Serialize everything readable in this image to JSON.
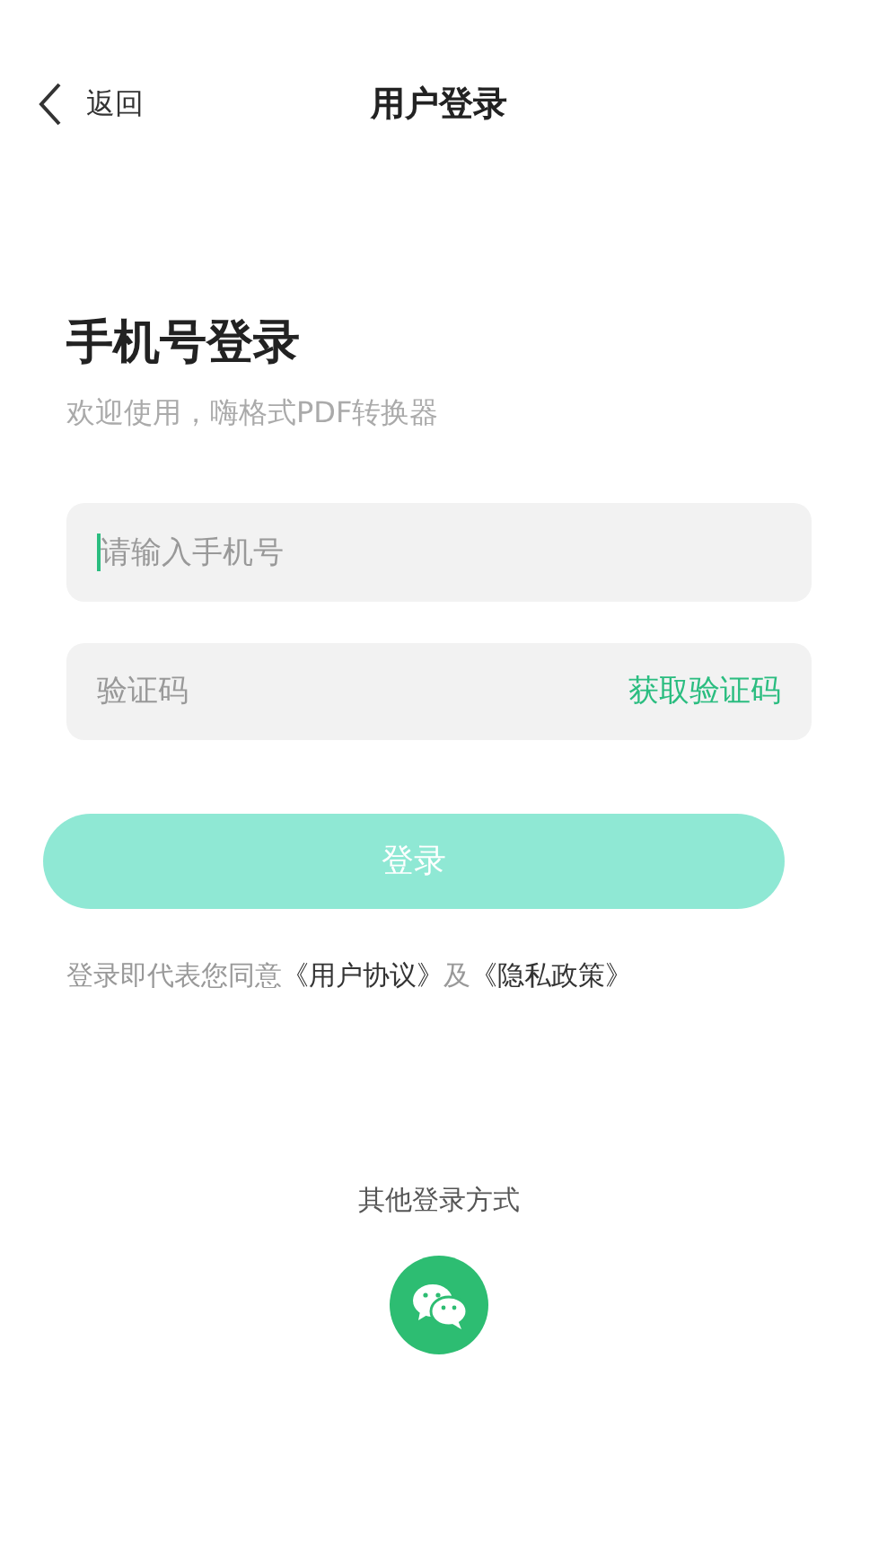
{
  "header": {
    "back": "返回",
    "title": "用户登录"
  },
  "heading": "手机号登录",
  "subtitle": "欢迎使用，嗨格式PDF转换器",
  "phone_field": {
    "placeholder": "请输入手机号"
  },
  "code_field": {
    "placeholder": "验证码",
    "action": "获取验证码"
  },
  "login_button": {
    "label": "登录",
    "disabled": true
  },
  "consent": {
    "text": "登录即代表您同意",
    "link_1": "《用户协议》",
    "joiner": "及",
    "link_2": "《隐私政策》"
  },
  "other_login": {
    "label": "其他登录方式"
  }
}
